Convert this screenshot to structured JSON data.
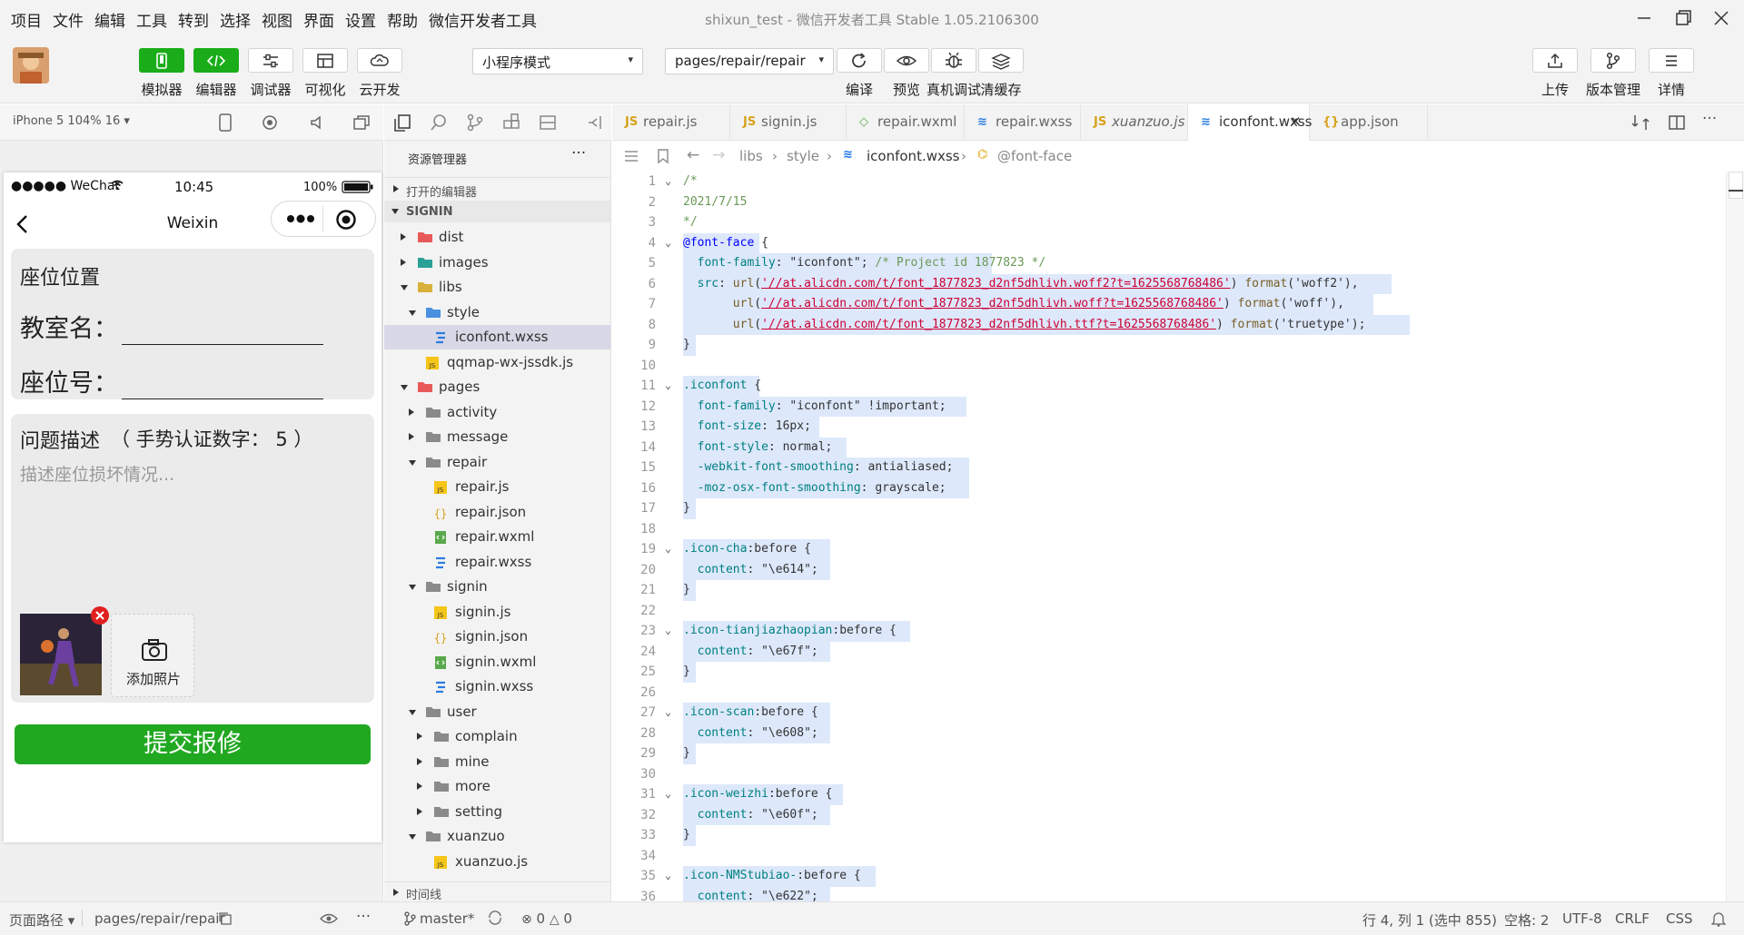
{
  "menubar": {
    "items": [
      "项目",
      "文件",
      "编辑",
      "工具",
      "转到",
      "选择",
      "视图",
      "界面",
      "设置",
      "帮助",
      "微信开发者工具"
    ],
    "title": "shixun_test - 微信开发者工具 Stable 1.05.2106300"
  },
  "toolbar": {
    "left_buttons": [
      {
        "label": "模拟器",
        "icon": "phone-icon"
      },
      {
        "label": "编辑器",
        "icon": "code-icon"
      },
      {
        "label": "调试器",
        "icon": "sliders-icon"
      },
      {
        "label": "可视化",
        "icon": "layout-icon"
      },
      {
        "label": "云开发",
        "icon": "cloud-icon"
      }
    ],
    "mode_select": "小程序模式",
    "page_select": "pages/repair/repair",
    "mid_buttons": [
      {
        "label": "编译",
        "icon": "refresh-icon"
      },
      {
        "label": "预览",
        "icon": "eye-icon"
      },
      {
        "label": "真机调试",
        "icon": "bug-icon"
      },
      {
        "label": "清缓存",
        "icon": "layers-icon"
      }
    ],
    "right_buttons": [
      {
        "label": "上传",
        "icon": "upload-icon"
      },
      {
        "label": "版本管理",
        "icon": "branch-icon"
      },
      {
        "label": "详情",
        "icon": "menu-icon"
      }
    ]
  },
  "simulator": {
    "device": "iPhone 5 104% 16",
    "status_signal": "●●●●● WeChat",
    "status_time": "10:45",
    "status_battery": "100%",
    "nav_title": "Weixin",
    "seat_section_title": "座位位置",
    "classroom_label": "教室名：",
    "seat_label": "座位号：",
    "problem_label": "问题描述",
    "gesture_hint": "（ 手势认证数字： 5 ）",
    "textarea_placeholder": "描述座位损坏情况...",
    "add_photo_label": "添加照片",
    "submit_label": "提交报修"
  },
  "explorer": {
    "header": "资源管理器",
    "more": "···",
    "open_editors": "打开的编辑器",
    "project": "SIGNIN",
    "timeline": "时间线",
    "tree": [
      {
        "label": "dist",
        "depth": 1,
        "kind": "folder-red",
        "state": "closed"
      },
      {
        "label": "images",
        "depth": 1,
        "kind": "folder-teal",
        "state": "closed"
      },
      {
        "label": "libs",
        "depth": 1,
        "kind": "folder-yellow",
        "state": "open"
      },
      {
        "label": "style",
        "depth": 2,
        "kind": "folder-blue",
        "state": "open"
      },
      {
        "label": "iconfont.wxss",
        "depth": 3,
        "kind": "wxss",
        "state": "none",
        "selected": true
      },
      {
        "label": "qqmap-wx-jssdk.js",
        "depth": 2,
        "kind": "js",
        "state": "none"
      },
      {
        "label": "pages",
        "depth": 1,
        "kind": "folder-red",
        "state": "open"
      },
      {
        "label": "activity",
        "depth": 2,
        "kind": "folder",
        "state": "closed"
      },
      {
        "label": "message",
        "depth": 2,
        "kind": "folder",
        "state": "closed"
      },
      {
        "label": "repair",
        "depth": 2,
        "kind": "folder",
        "state": "open"
      },
      {
        "label": "repair.js",
        "depth": 3,
        "kind": "js",
        "state": "none"
      },
      {
        "label": "repair.json",
        "depth": 3,
        "kind": "json",
        "state": "none"
      },
      {
        "label": "repair.wxml",
        "depth": 3,
        "kind": "wxml",
        "state": "none"
      },
      {
        "label": "repair.wxss",
        "depth": 3,
        "kind": "wxss",
        "state": "none"
      },
      {
        "label": "signin",
        "depth": 2,
        "kind": "folder",
        "state": "open"
      },
      {
        "label": "signin.js",
        "depth": 3,
        "kind": "js",
        "state": "none"
      },
      {
        "label": "signin.json",
        "depth": 3,
        "kind": "json",
        "state": "none"
      },
      {
        "label": "signin.wxml",
        "depth": 3,
        "kind": "wxml",
        "state": "none"
      },
      {
        "label": "signin.wxss",
        "depth": 3,
        "kind": "wxss",
        "state": "none"
      },
      {
        "label": "user",
        "depth": 2,
        "kind": "folder",
        "state": "open"
      },
      {
        "label": "complain",
        "depth": 3,
        "kind": "folder",
        "state": "closed"
      },
      {
        "label": "mine",
        "depth": 3,
        "kind": "folder",
        "state": "closed"
      },
      {
        "label": "more",
        "depth": 3,
        "kind": "folder",
        "state": "closed"
      },
      {
        "label": "setting",
        "depth": 3,
        "kind": "folder",
        "state": "closed"
      },
      {
        "label": "xuanzuo",
        "depth": 2,
        "kind": "folder",
        "state": "open"
      },
      {
        "label": "xuanzuo.js",
        "depth": 3,
        "kind": "js",
        "state": "none"
      }
    ]
  },
  "tabs": [
    {
      "label": "repair.js",
      "kind": "js",
      "active": false
    },
    {
      "label": "signin.js",
      "kind": "js",
      "active": false
    },
    {
      "label": "repair.wxml",
      "kind": "wxml",
      "active": false
    },
    {
      "label": "repair.wxss",
      "kind": "wxss",
      "active": false
    },
    {
      "label": "xuanzuo.js",
      "kind": "js",
      "active": false,
      "italic": true
    },
    {
      "label": "iconfont.wxss",
      "kind": "wxss",
      "active": true
    },
    {
      "label": "app.json",
      "kind": "json",
      "active": false
    }
  ],
  "breadcrumb": [
    "libs",
    "style",
    "iconfont.wxss",
    "@font-face"
  ],
  "code_lines": [
    {
      "n": 1,
      "fold": true,
      "segs": [
        [
          "/*",
          "com"
        ]
      ]
    },
    {
      "n": 2,
      "segs": [
        [
          "2021/7/15",
          "com"
        ]
      ]
    },
    {
      "n": 3,
      "segs": [
        [
          "*/",
          "com"
        ]
      ]
    },
    {
      "n": 4,
      "fold": true,
      "sel": 84,
      "segs": [
        [
          "@font-face",
          "kw"
        ],
        [
          " {",
          "def"
        ]
      ]
    },
    {
      "n": 5,
      "sel": 340,
      "segs": [
        [
          "  font-family",
          "prop"
        ],
        [
          ": ",
          "def"
        ],
        [
          "\"iconfont\"",
          "str"
        ],
        [
          "; ",
          "def"
        ],
        [
          "/* Project id 1877823 */",
          "com"
        ]
      ]
    },
    {
      "n": 6,
      "sel": 780,
      "segs": [
        [
          "  src",
          "prop"
        ],
        [
          ": ",
          "def"
        ],
        [
          "url",
          "fn"
        ],
        [
          "(",
          "def"
        ],
        [
          "'//at.alicdn.com/t/font_1877823_d2nf5dhlivh.woff2?t=1625568768486'",
          "url"
        ],
        [
          ") ",
          "def"
        ],
        [
          "format",
          "fn"
        ],
        [
          "(",
          "def"
        ],
        [
          "'woff2'",
          "str"
        ],
        [
          "),",
          "def"
        ]
      ]
    },
    {
      "n": 7,
      "sel": 760,
      "segs": [
        [
          "       url",
          "fn"
        ],
        [
          "(",
          "def"
        ],
        [
          "'//at.alicdn.com/t/font_1877823_d2nf5dhlivh.woff?t=1625568768486'",
          "url"
        ],
        [
          ") ",
          "def"
        ],
        [
          "format",
          "fn"
        ],
        [
          "(",
          "def"
        ],
        [
          "'woff'",
          "str"
        ],
        [
          "),",
          "def"
        ]
      ]
    },
    {
      "n": 8,
      "sel": 800,
      "segs": [
        [
          "       url",
          "fn"
        ],
        [
          "(",
          "def"
        ],
        [
          "'//at.alicdn.com/t/font_1877823_d2nf5dhlivh.ttf?t=1625568768486'",
          "url"
        ],
        [
          ") ",
          "def"
        ],
        [
          "format",
          "fn"
        ],
        [
          "(",
          "def"
        ],
        [
          "'truetype'",
          "str"
        ],
        [
          ");",
          "def"
        ]
      ]
    },
    {
      "n": 9,
      "sel": 14,
      "segs": [
        [
          "}",
          "def"
        ]
      ]
    },
    {
      "n": 10,
      "segs": []
    },
    {
      "n": 11,
      "fold": true,
      "sel": 84,
      "segs": [
        [
          ".iconfont",
          "sel"
        ],
        [
          " {",
          "def"
        ]
      ]
    },
    {
      "n": 12,
      "sel": 312,
      "segs": [
        [
          "  font-family",
          "prop"
        ],
        [
          ": ",
          "def"
        ],
        [
          "\"iconfont\"",
          "str"
        ],
        [
          " !important;",
          "def"
        ]
      ]
    },
    {
      "n": 13,
      "sel": 150,
      "segs": [
        [
          "  font-size",
          "prop"
        ],
        [
          ": ",
          "def"
        ],
        [
          "16px",
          "str"
        ],
        [
          ";",
          "def"
        ]
      ]
    },
    {
      "n": 14,
      "sel": 180,
      "segs": [
        [
          "  font-style",
          "prop"
        ],
        [
          ": ",
          "def"
        ],
        [
          "normal",
          "str"
        ],
        [
          ";",
          "def"
        ]
      ]
    },
    {
      "n": 15,
      "sel": 315,
      "segs": [
        [
          "  -webkit-font-smoothing",
          "prop"
        ],
        [
          ": ",
          "def"
        ],
        [
          "antialiased",
          "str"
        ],
        [
          ";",
          "def"
        ]
      ]
    },
    {
      "n": 16,
      "sel": 315,
      "segs": [
        [
          "  -moz-osx-font-smoothing",
          "prop"
        ],
        [
          ": ",
          "def"
        ],
        [
          "grayscale",
          "str"
        ],
        [
          ";",
          "def"
        ]
      ]
    },
    {
      "n": 17,
      "sel": 14,
      "segs": [
        [
          "}",
          "def"
        ]
      ]
    },
    {
      "n": 18,
      "segs": []
    },
    {
      "n": 19,
      "fold": true,
      "sel": 162,
      "segs": [
        [
          ".icon-cha",
          "sel"
        ],
        [
          ":before {",
          "def"
        ]
      ]
    },
    {
      "n": 20,
      "sel": 162,
      "segs": [
        [
          "  content",
          "prop"
        ],
        [
          ": ",
          "def"
        ],
        [
          "\"\\e614\"",
          "str"
        ],
        [
          ";",
          "def"
        ]
      ]
    },
    {
      "n": 21,
      "sel": 14,
      "segs": [
        [
          "}",
          "def"
        ]
      ]
    },
    {
      "n": 22,
      "segs": []
    },
    {
      "n": 23,
      "fold": true,
      "sel": 250,
      "segs": [
        [
          ".icon-tianjiazhaopian",
          "sel"
        ],
        [
          ":before {",
          "def"
        ]
      ]
    },
    {
      "n": 24,
      "sel": 162,
      "segs": [
        [
          "  content",
          "prop"
        ],
        [
          ": ",
          "def"
        ],
        [
          "\"\\e67f\"",
          "str"
        ],
        [
          ";",
          "def"
        ]
      ]
    },
    {
      "n": 25,
      "sel": 14,
      "segs": [
        [
          "}",
          "def"
        ]
      ]
    },
    {
      "n": 26,
      "segs": []
    },
    {
      "n": 27,
      "fold": true,
      "sel": 162,
      "segs": [
        [
          ".icon-scan",
          "sel"
        ],
        [
          ":before {",
          "def"
        ]
      ]
    },
    {
      "n": 28,
      "sel": 162,
      "segs": [
        [
          "  content",
          "prop"
        ],
        [
          ": ",
          "def"
        ],
        [
          "\"\\e608\"",
          "str"
        ],
        [
          ";",
          "def"
        ]
      ]
    },
    {
      "n": 29,
      "sel": 14,
      "segs": [
        [
          "}",
          "def"
        ]
      ]
    },
    {
      "n": 30,
      "segs": []
    },
    {
      "n": 31,
      "fold": true,
      "sel": 176,
      "segs": [
        [
          ".icon-weizhi",
          "sel"
        ],
        [
          ":before {",
          "def"
        ]
      ]
    },
    {
      "n": 32,
      "sel": 162,
      "segs": [
        [
          "  content",
          "prop"
        ],
        [
          ": ",
          "def"
        ],
        [
          "\"\\e60f\"",
          "str"
        ],
        [
          ";",
          "def"
        ]
      ]
    },
    {
      "n": 33,
      "sel": 14,
      "segs": [
        [
          "}",
          "def"
        ]
      ]
    },
    {
      "n": 34,
      "segs": []
    },
    {
      "n": 35,
      "fold": true,
      "sel": 212,
      "segs": [
        [
          ".icon-NMStubiao-",
          "sel"
        ],
        [
          ":before {",
          "def"
        ]
      ]
    },
    {
      "n": 36,
      "sel": 162,
      "segs": [
        [
          "  content",
          "prop"
        ],
        [
          ": ",
          "def"
        ],
        [
          "\"\\e622\"",
          "str"
        ],
        [
          ";",
          "def"
        ]
      ]
    }
  ],
  "statusbar": {
    "page_path_label": "页面路径",
    "page_path": "pages/repair/repair",
    "branch": "master*",
    "errors": "0",
    "warnings": "0",
    "cursor": "行 4, 列 1 (选中 855)",
    "spaces": "空格: 2",
    "encoding": "UTF-8",
    "eol": "CRLF",
    "language": "CSS"
  },
  "colors": {
    "accent_green": "#1aad19",
    "submit_green": "#21a821",
    "selection": "#dde8fb"
  }
}
